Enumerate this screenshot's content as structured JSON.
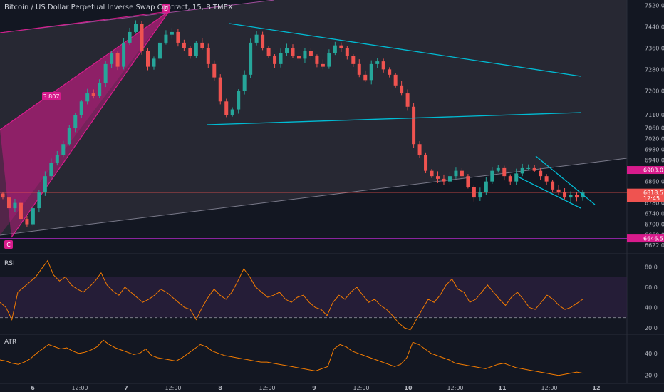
{
  "header": {
    "title": "Bitcoin / US Dollar Perpetual Inverse Swap Contract, 15, BITMEX"
  },
  "panes": {
    "rsi_label": "RSI",
    "atr_label": "ATR"
  },
  "colors": {
    "background": "#131722",
    "up": "#26a69a",
    "down": "#ef5350",
    "trendline": "#00bcd4",
    "pattern": "#d81b8c",
    "oscillator": "#f57c00",
    "axis_text": "#b2b5be"
  },
  "chart_data": [
    {
      "type": "candlestick",
      "title": "Bitcoin / US Dollar Perpetual Inverse Swap Contract, 15, BITMEX",
      "ylim": [
        6600,
        7540
      ],
      "y_ticks": [
        6622.0,
        6660.0,
        6700.0,
        6740.0,
        6780.0,
        6860.0,
        6940.0,
        6980.0,
        7020.0,
        7060.0,
        7110.0,
        7200.0,
        7280.0,
        7360.0,
        7440.0,
        7520.0
      ],
      "x_ticks": [
        "6",
        "12:00",
        "7",
        "12:00",
        "8",
        "12:00",
        "9",
        "12:00",
        "10",
        "12:00",
        "11",
        "12:00",
        "12"
      ],
      "price_labels": [
        {
          "text": "6903.0",
          "value": 6903,
          "color": "#d81b8c"
        },
        {
          "text": "6818.5",
          "value": 6818.5,
          "color": "#ef5350"
        },
        {
          "text": "12:45",
          "value": 6798,
          "color": "#ef5350"
        },
        {
          "text": "6646.5",
          "value": 6646.5,
          "color": "#d81b8c"
        }
      ],
      "pattern_labels": [
        {
          "text": "D",
          "point": "D"
        },
        {
          "text": "C",
          "point": "C"
        },
        {
          "text": "3.807",
          "point": "ratio"
        }
      ],
      "close_series": [
        6800,
        6760,
        6780,
        6720,
        6700,
        6760,
        6820,
        6880,
        6930,
        6960,
        7000,
        7060,
        7110,
        7160,
        7190,
        7180,
        7230,
        7300,
        7340,
        7290,
        7380,
        7420,
        7450,
        7350,
        7290,
        7320,
        7380,
        7410,
        7420,
        7380,
        7360,
        7330,
        7380,
        7360,
        7300,
        7250,
        7160,
        7110,
        7130,
        7200,
        7260,
        7380,
        7410,
        7360,
        7330,
        7300,
        7340,
        7360,
        7330,
        7320,
        7350,
        7330,
        7300,
        7290,
        7340,
        7370,
        7360,
        7330,
        7300,
        7260,
        7240,
        7300,
        7310,
        7280,
        7260,
        7220,
        7190,
        7140,
        7000,
        6960,
        6900,
        6880,
        6870,
        6860,
        6880,
        6900,
        6880,
        6840,
        6800,
        6820,
        6860,
        6900,
        6910,
        6880,
        6860,
        6890,
        6910,
        6910,
        6900,
        6880,
        6860,
        6830,
        6820,
        6800,
        6810,
        6800,
        6818.5
      ]
    },
    {
      "type": "line",
      "title": "RSI",
      "ylim": [
        15,
        90
      ],
      "y_ticks": [
        20.0,
        40.0,
        60.0,
        80.0
      ],
      "bands": [
        30,
        70
      ],
      "values": [
        45,
        40,
        28,
        55,
        60,
        65,
        70,
        78,
        86,
        72,
        66,
        70,
        62,
        58,
        55,
        60,
        66,
        74,
        62,
        56,
        52,
        60,
        55,
        50,
        45,
        48,
        52,
        58,
        55,
        50,
        45,
        40,
        38,
        28,
        40,
        50,
        58,
        52,
        48,
        55,
        66,
        78,
        70,
        60,
        55,
        50,
        52,
        55,
        48,
        45,
        50,
        52,
        45,
        40,
        38,
        32,
        45,
        52,
        48,
        55,
        60,
        52,
        45,
        48,
        42,
        38,
        32,
        25,
        20,
        18,
        28,
        38,
        48,
        45,
        52,
        62,
        68,
        58,
        55,
        45,
        48,
        55,
        62,
        55,
        48,
        42,
        50,
        55,
        48,
        40,
        38,
        45,
        52,
        48,
        42,
        38,
        40,
        44,
        48
      ]
    },
    {
      "type": "line",
      "title": "ATR",
      "ylim": [
        14,
        56
      ],
      "y_ticks": [
        20.0,
        40.0
      ],
      "values": [
        34,
        33,
        31,
        30,
        32,
        35,
        40,
        44,
        48,
        46,
        44,
        45,
        42,
        40,
        41,
        43,
        46,
        52,
        48,
        45,
        43,
        41,
        39,
        40,
        44,
        38,
        36,
        35,
        34,
        33,
        36,
        40,
        44,
        48,
        46,
        42,
        40,
        38,
        37,
        36,
        35,
        34,
        33,
        32,
        32,
        31,
        30,
        29,
        28,
        27,
        26,
        25,
        24,
        26,
        28,
        44,
        48,
        46,
        42,
        40,
        38,
        36,
        34,
        32,
        30,
        28,
        30,
        36,
        50,
        48,
        44,
        40,
        38,
        36,
        34,
        31,
        30,
        29,
        28,
        27,
        26,
        28,
        30,
        31,
        29,
        27,
        26,
        25,
        24,
        23,
        22,
        21,
        20,
        21,
        22,
        23,
        22
      ]
    }
  ]
}
